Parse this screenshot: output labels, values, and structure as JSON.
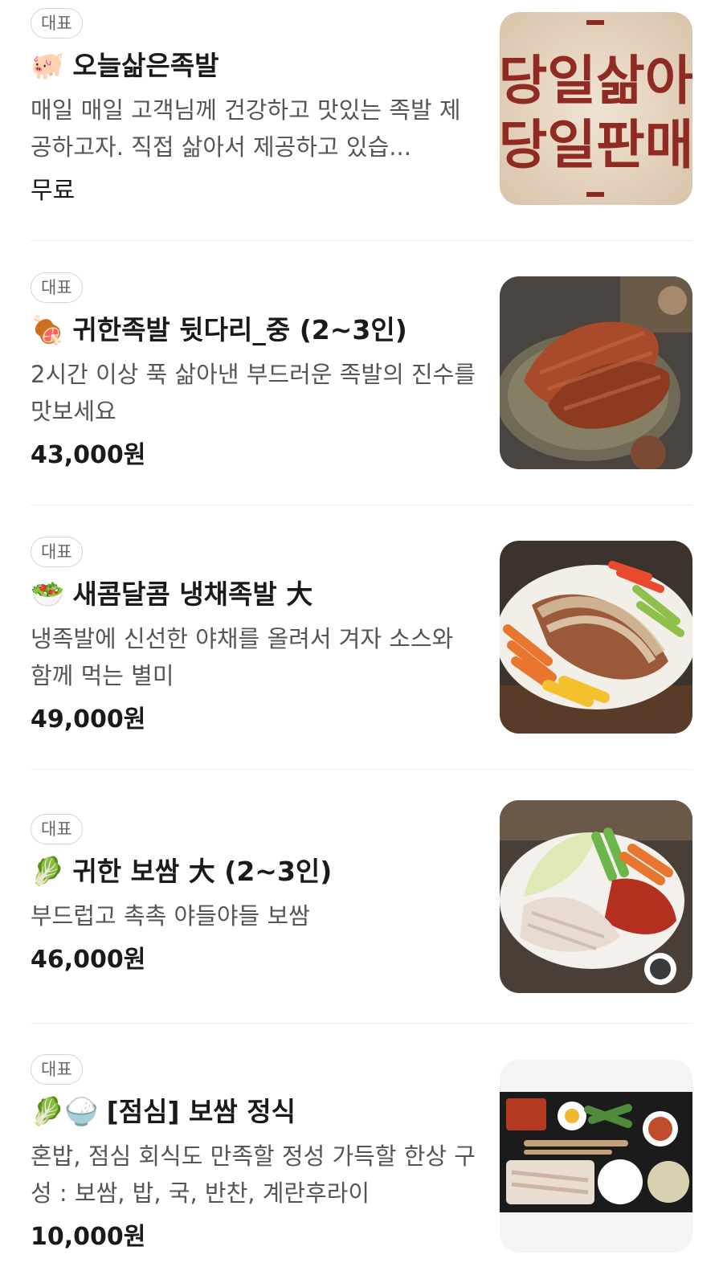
{
  "menu": [
    {
      "badge": "대표",
      "emoji": "🐖",
      "name": "오늘삶은족발",
      "description": "매일 매일 고객님께 건강하고 맛있는 족발 제공하고자. 직접 삶아서 제공하고 있습...",
      "price": "무료",
      "image_text_line1": "당일삶아",
      "image_text_line2": "당일판매"
    },
    {
      "badge": "대표",
      "emoji": "🍖",
      "name": "귀한족발 뒷다리_중 (2~3인)",
      "description": "2시간 이상 푹 삶아낸 부드러운 족발의 진수를 맛보세요",
      "price": "43,000원"
    },
    {
      "badge": "대표",
      "emoji": "🥗",
      "name": "새콤달콤 냉채족발 大",
      "description": "냉족발에 신선한 야채를 올려서 겨자 소스와 함께 먹는 별미",
      "price": "49,000원"
    },
    {
      "badge": "대표",
      "emoji": "🥬",
      "name": "귀한 보쌈 大 (2~3인)",
      "description": "부드럽고 촉촉 야들야들 보쌈",
      "price": "46,000원"
    },
    {
      "badge": "대표",
      "emoji": "🥬🍚",
      "name": "[점심] 보쌈 정식",
      "description": "혼밥, 점심 회식도 만족할 정성 가득할 한상 구성 : 보쌈, 밥, 국, 반찬, 계란후라이",
      "price": "10,000원"
    }
  ]
}
